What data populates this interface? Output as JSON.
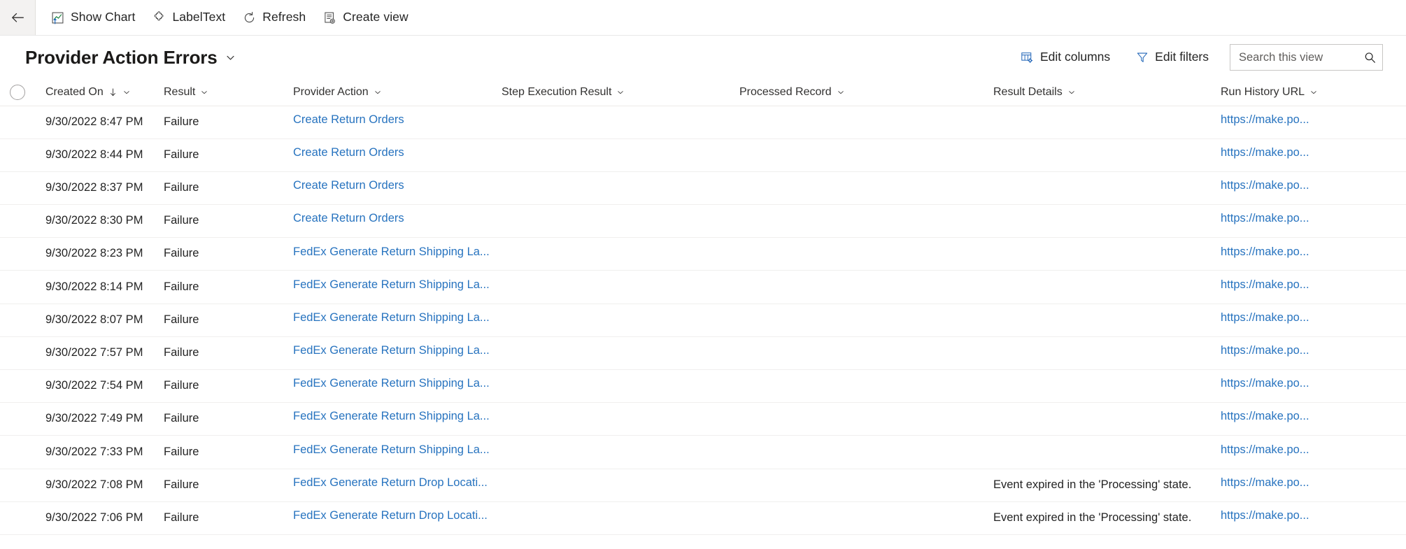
{
  "command_bar": {
    "back_label": "Back",
    "buttons": [
      {
        "label": "Show Chart",
        "icon": "show-chart-icon"
      },
      {
        "label": "LabelText",
        "icon": "puzzle-piece-icon"
      },
      {
        "label": "Refresh",
        "icon": "refresh-icon"
      },
      {
        "label": "Create view",
        "icon": "create-view-icon"
      }
    ]
  },
  "view_header": {
    "title": "Provider Action Errors",
    "title_chevron": "chevron-down-icon",
    "edit_columns_label": "Edit columns",
    "edit_filters_label": "Edit filters",
    "search_placeholder": "Search this view",
    "search_value": ""
  },
  "grid": {
    "select_all_label": "Select all rows",
    "sort_column": "Created On",
    "sort_direction": "ascending",
    "columns": [
      {
        "key": "created_on",
        "label": "Created On",
        "sorted": true,
        "sort_glyph": "↓"
      },
      {
        "key": "result",
        "label": "Result",
        "sorted": false
      },
      {
        "key": "provider_action",
        "label": "Provider Action",
        "sorted": false
      },
      {
        "key": "step_execution_result",
        "label": "Step Execution Result",
        "sorted": false
      },
      {
        "key": "processed_record",
        "label": "Processed Record",
        "sorted": false
      },
      {
        "key": "result_details",
        "label": "Result Details",
        "sorted": false
      },
      {
        "key": "run_history_url",
        "label": "Run History URL",
        "sorted": false
      }
    ],
    "rows": [
      {
        "created_on": "9/30/2022 8:47 PM",
        "result": "Failure",
        "provider_action": "Create Return Orders",
        "step_execution_result": "",
        "processed_record": "",
        "result_details": "",
        "run_history_url": "https://make.po..."
      },
      {
        "created_on": "9/30/2022 8:44 PM",
        "result": "Failure",
        "provider_action": "Create Return Orders",
        "step_execution_result": "",
        "processed_record": "",
        "result_details": "",
        "run_history_url": "https://make.po..."
      },
      {
        "created_on": "9/30/2022 8:37 PM",
        "result": "Failure",
        "provider_action": "Create Return Orders",
        "step_execution_result": "",
        "processed_record": "",
        "result_details": "",
        "run_history_url": "https://make.po..."
      },
      {
        "created_on": "9/30/2022 8:30 PM",
        "result": "Failure",
        "provider_action": "Create Return Orders",
        "step_execution_result": "",
        "processed_record": "",
        "result_details": "",
        "run_history_url": "https://make.po..."
      },
      {
        "created_on": "9/30/2022 8:23 PM",
        "result": "Failure",
        "provider_action": "FedEx Generate Return Shipping La...",
        "step_execution_result": "",
        "processed_record": "",
        "result_details": "",
        "run_history_url": "https://make.po..."
      },
      {
        "created_on": "9/30/2022 8:14 PM",
        "result": "Failure",
        "provider_action": "FedEx Generate Return Shipping La...",
        "step_execution_result": "",
        "processed_record": "",
        "result_details": "",
        "run_history_url": "https://make.po..."
      },
      {
        "created_on": "9/30/2022 8:07 PM",
        "result": "Failure",
        "provider_action": "FedEx Generate Return Shipping La...",
        "step_execution_result": "",
        "processed_record": "",
        "result_details": "",
        "run_history_url": "https://make.po..."
      },
      {
        "created_on": "9/30/2022 7:57 PM",
        "result": "Failure",
        "provider_action": "FedEx Generate Return Shipping La...",
        "step_execution_result": "",
        "processed_record": "",
        "result_details": "",
        "run_history_url": "https://make.po..."
      },
      {
        "created_on": "9/30/2022 7:54 PM",
        "result": "Failure",
        "provider_action": "FedEx Generate Return Shipping La...",
        "step_execution_result": "",
        "processed_record": "",
        "result_details": "",
        "run_history_url": "https://make.po..."
      },
      {
        "created_on": "9/30/2022 7:49 PM",
        "result": "Failure",
        "provider_action": "FedEx Generate Return Shipping La...",
        "step_execution_result": "",
        "processed_record": "",
        "result_details": "",
        "run_history_url": "https://make.po..."
      },
      {
        "created_on": "9/30/2022 7:33 PM",
        "result": "Failure",
        "provider_action": "FedEx Generate Return Shipping La...",
        "step_execution_result": "",
        "processed_record": "",
        "result_details": "",
        "run_history_url": "https://make.po..."
      },
      {
        "created_on": "9/30/2022 7:08 PM",
        "result": "Failure",
        "provider_action": "FedEx Generate Return Drop Locati...",
        "step_execution_result": "",
        "processed_record": "",
        "result_details": "Event expired in the 'Processing' state.",
        "run_history_url": "https://make.po..."
      },
      {
        "created_on": "9/30/2022 7:06 PM",
        "result": "Failure",
        "provider_action": "FedEx Generate Return Drop Locati...",
        "step_execution_result": "",
        "processed_record": "",
        "result_details": "Event expired in the 'Processing' state.",
        "run_history_url": "https://make.po..."
      }
    ]
  },
  "colors": {
    "link": "#2773bf",
    "text": "#242424",
    "header_text": "#323130",
    "border": "#f0efee",
    "accent": "#0078d4"
  }
}
